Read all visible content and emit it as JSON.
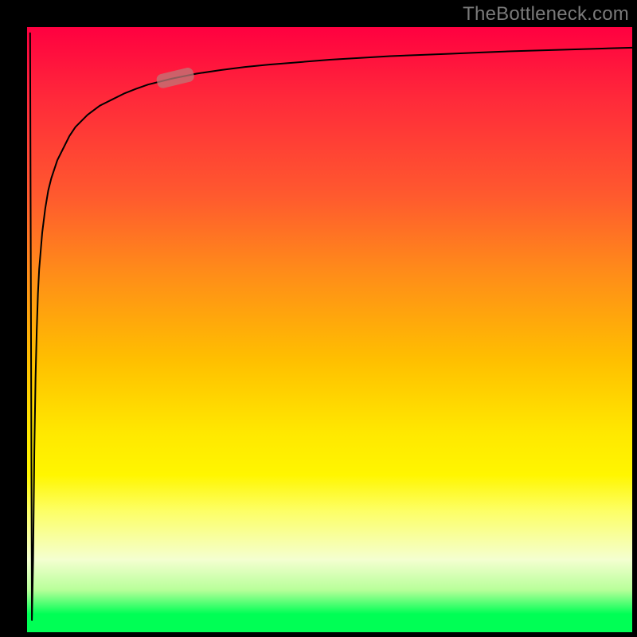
{
  "watermark": "TheBottleneck.com",
  "chart_data": {
    "type": "line",
    "title": "",
    "xlabel": "",
    "ylabel": "",
    "xlim": [
      0,
      100
    ],
    "ylim": [
      0,
      100
    ],
    "series": [
      {
        "name": "curve",
        "x": [
          0.5,
          0.8,
          1.0,
          1.2,
          1.4,
          1.6,
          1.8,
          2.0,
          2.5,
          3.0,
          3.5,
          4.0,
          5.0,
          6.0,
          7.0,
          8.0,
          10.0,
          12.0,
          14.0,
          16.0,
          18.0,
          20.0,
          24.0,
          28.0,
          32.0,
          36.0,
          40.0,
          45.0,
          50.0,
          55.0,
          60.0,
          65.0,
          70.0,
          75.0,
          80.0,
          85.0,
          90.0,
          95.0,
          100.0
        ],
        "values": [
          99.0,
          2.0,
          12.0,
          30.0,
          42.0,
          50.0,
          56.0,
          60.0,
          66.0,
          70.0,
          73.0,
          75.0,
          78.0,
          80.0,
          82.0,
          83.5,
          85.5,
          87.0,
          88.0,
          89.0,
          89.8,
          90.5,
          91.5,
          92.3,
          92.9,
          93.4,
          93.8,
          94.2,
          94.6,
          94.9,
          95.2,
          95.4,
          95.6,
          95.8,
          96.0,
          96.15,
          96.3,
          96.45,
          96.6
        ]
      }
    ],
    "marker": {
      "x_start": 22.0,
      "y_start": 91.0,
      "x_end": 27.0,
      "y_end": 92.2
    },
    "background_gradient": [
      {
        "stop": 0.0,
        "color": "#ff0040"
      },
      {
        "stop": 0.12,
        "color": "#ff2a3a"
      },
      {
        "stop": 0.28,
        "color": "#ff5a2e"
      },
      {
        "stop": 0.4,
        "color": "#ff8a1a"
      },
      {
        "stop": 0.55,
        "color": "#ffbf00"
      },
      {
        "stop": 0.67,
        "color": "#ffe800"
      },
      {
        "stop": 0.74,
        "color": "#fff600"
      },
      {
        "stop": 0.8,
        "color": "#fdff66"
      },
      {
        "stop": 0.88,
        "color": "#f4ffd0"
      },
      {
        "stop": 0.93,
        "color": "#b8ff9a"
      },
      {
        "stop": 0.97,
        "color": "#00ff55"
      },
      {
        "stop": 1.0,
        "color": "#00ff55"
      }
    ],
    "grid": false,
    "legend": false
  }
}
